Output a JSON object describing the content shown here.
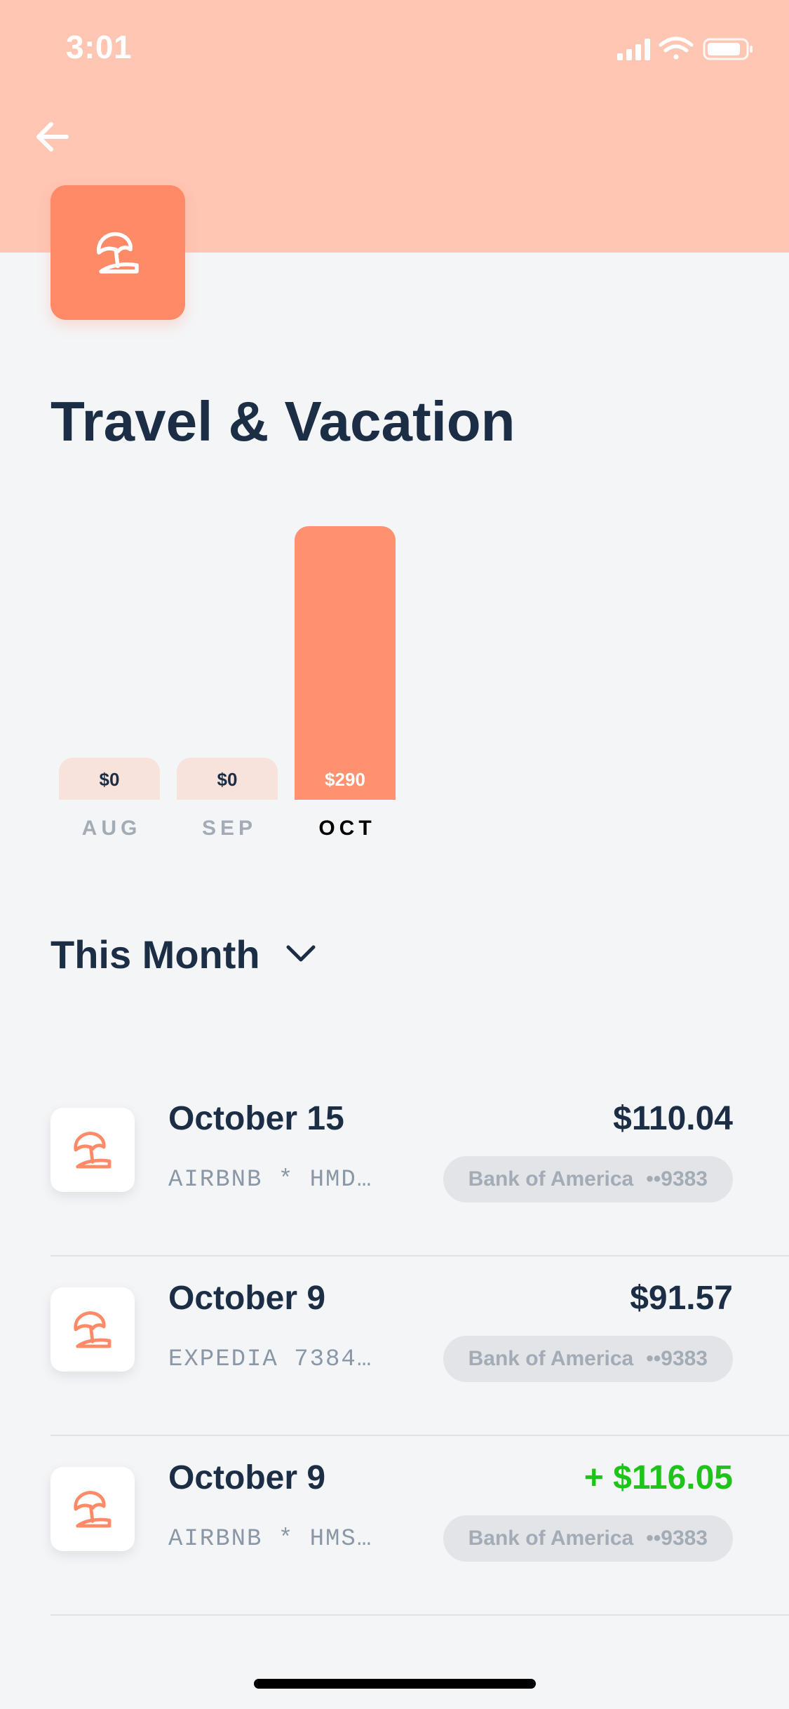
{
  "status_bar": {
    "time": "3:01"
  },
  "header": {
    "title": "Travel & Vacation",
    "category_icon": "beach-umbrella-icon"
  },
  "colors": {
    "header_band": "#ffc6b3",
    "accent": "#ff8a67",
    "bar_active": "#ff9070",
    "bar_inactive": "#f8e2dc",
    "text_dark": "#1c2e45",
    "credit_green": "#1fc41a"
  },
  "chart_data": {
    "type": "bar",
    "categories": [
      "AUG",
      "SEP",
      "OCT"
    ],
    "values": [
      0,
      0,
      290
    ],
    "value_labels": [
      "$0",
      "$0",
      "$290"
    ],
    "active_index": 2
  },
  "period_selector": {
    "label": "This Month"
  },
  "transactions": [
    {
      "date": "October 15",
      "merchant": "AIRBNB * HMD…",
      "amount": "$110.04",
      "credit": false,
      "bank": "Bank of America",
      "account": "••9383"
    },
    {
      "date": "October 9",
      "merchant": "EXPEDIA 7384…",
      "amount": "$91.57",
      "credit": false,
      "bank": "Bank of America",
      "account": "••9383"
    },
    {
      "date": "October 9",
      "merchant": "AIRBNB * HMS…",
      "amount": "+ $116.05",
      "credit": true,
      "bank": "Bank of America",
      "account": "••9383"
    }
  ]
}
